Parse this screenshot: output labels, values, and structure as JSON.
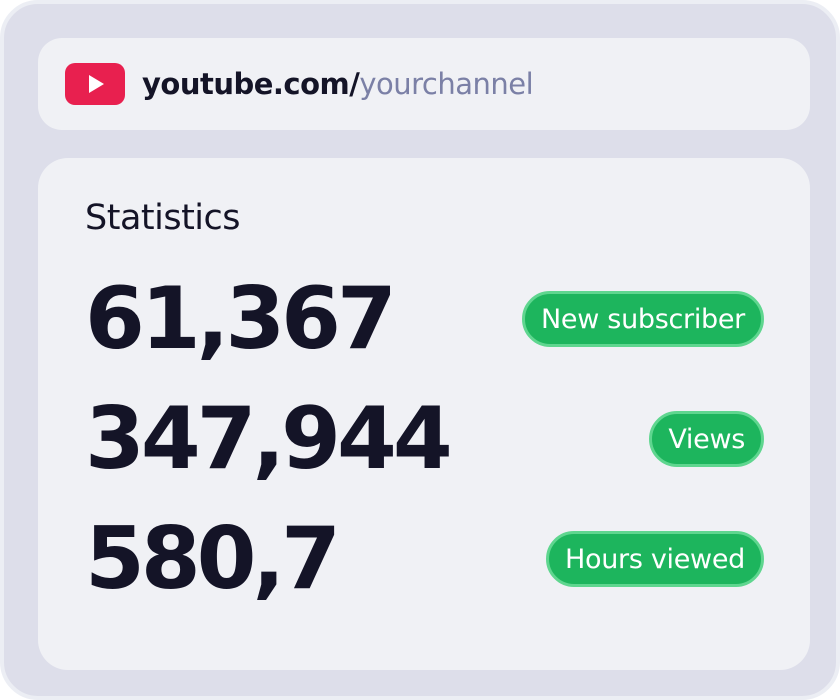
{
  "url": {
    "domain": "youtube.com/",
    "path": "yourchannel",
    "icon": "youtube-play-icon",
    "icon_color": "#e8204f"
  },
  "statistics": {
    "title": "Statistics",
    "items": [
      {
        "value": "61,367",
        "label": "New subscriber"
      },
      {
        "value": "347,944",
        "label": "Views"
      },
      {
        "value": "580,7",
        "label": "Hours viewed"
      }
    ]
  },
  "colors": {
    "badge": "#1db55d",
    "text": "#141427",
    "path": "#7b80a6",
    "frame": "#dddeea"
  }
}
